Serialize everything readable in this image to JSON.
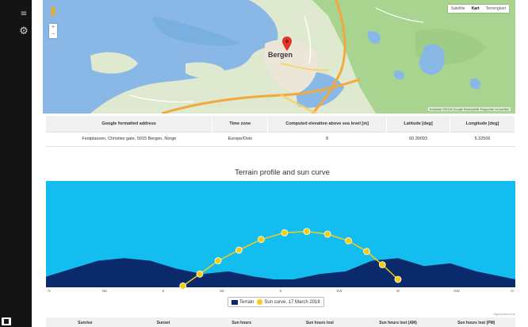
{
  "map": {
    "city_label": "Bergen",
    "type_buttons": [
      "Satellite",
      "Kart",
      "Terrengkart"
    ],
    "active_type": "Kart",
    "footer": "Kartdata ©2018 Google   Bruksvilkår   Rapporter en kartfeil"
  },
  "info_table": {
    "headers": [
      "Google formatted address",
      "Time zone",
      "Computed elevation above sea level [m]",
      "Latitude [deg]",
      "Longitude [deg]"
    ],
    "row": [
      "Festplassen, Christies gate, 5015 Bergen, Norge",
      "Europe/Oslo",
      "8",
      "60.39093",
      "5.32506"
    ]
  },
  "chart_data": {
    "type": "area",
    "title": "Terrain profile and sun curve",
    "x_tick_labels": [
      "N",
      "NE",
      "E",
      "SE",
      "S",
      "SW",
      "W",
      "NW",
      "N"
    ],
    "ylim": [
      0,
      40
    ],
    "series": [
      {
        "name": "Terrain",
        "color": "#0a2a6b",
        "azimuth": [
          0,
          20,
          40,
          60,
          80,
          100,
          120,
          140,
          160,
          175,
          190,
          210,
          230,
          250,
          270,
          290,
          310,
          330,
          360
        ],
        "values": [
          4,
          7,
          10,
          11,
          10,
          7,
          5,
          6,
          4,
          3,
          3,
          5,
          6,
          10,
          11,
          8,
          9,
          6,
          3
        ]
      },
      {
        "name": "Sun curve, 17 March 2018",
        "color": "#f5cc12",
        "azimuth": [
          105,
          118,
          132,
          148,
          165,
          183,
          200,
          216,
          232,
          246,
          258,
          270
        ],
        "values": [
          0.5,
          5,
          10,
          14,
          18,
          20.5,
          21,
          20,
          17.5,
          13.5,
          8.5,
          3
        ]
      }
    ],
    "sky_color": "#14bdf0"
  },
  "legend": {
    "terrain_label": "Terrain",
    "sun_label": "Sun curve, 17 March 2018"
  },
  "credit": "Highcharts.com",
  "bottom_table": {
    "headers": [
      "Sunrise",
      "Sunset",
      "Sun hours",
      "Sun hours lost",
      "Sun hours lost (AM)",
      "Sun hours lost (PM)"
    ]
  }
}
